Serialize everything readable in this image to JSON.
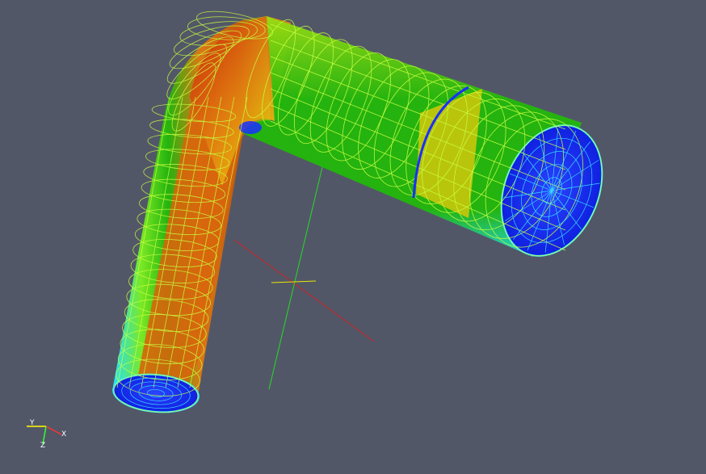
{
  "viewport": {
    "background": "#525768"
  },
  "orientation_axes": {
    "y_label": "Y",
    "x_label": "X",
    "z_label": "Z",
    "y_color": "#ffff00",
    "x_color": "#ff3333",
    "z_color": "#33ff33"
  },
  "mesh": {
    "colors": {
      "blue": "#1a2fff",
      "cyan": "#22e8ff",
      "green": "#22b80a",
      "lime": "#7cf020",
      "yellow": "#f2f20a",
      "orange": "#e07a10",
      "red": "#c81a08",
      "wire_light": "#c8ff40",
      "wire_cyan": "#3aefff"
    }
  },
  "widget_axes": {
    "x_color": "#cc2222",
    "y_color": "#22dd22",
    "z_color": "#e8e800"
  }
}
